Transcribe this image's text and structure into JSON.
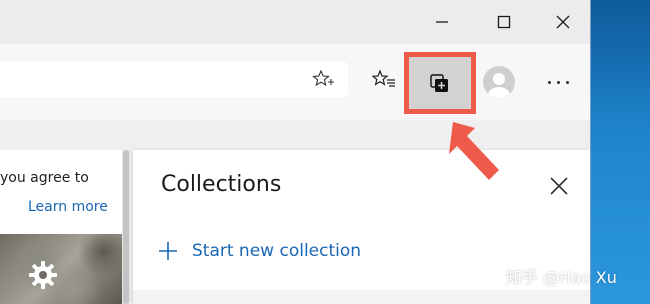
{
  "window_controls": {
    "minimize": "minimize-icon",
    "maximize": "maximize-icon",
    "close": "close-icon"
  },
  "toolbar": {
    "favorite_star": "star-add-icon",
    "favorites": "favorites-icon",
    "collections": "collections-icon",
    "profile": "avatar-icon",
    "more": "more-icon"
  },
  "page": {
    "consent_text": "you agree to",
    "learn_more": "Learn more"
  },
  "collections_panel": {
    "title": "Collections",
    "new_collection": "Start new collection"
  },
  "highlight": {
    "color": "#ef5b4b"
  },
  "watermark": "知乎 @Hao Xu"
}
